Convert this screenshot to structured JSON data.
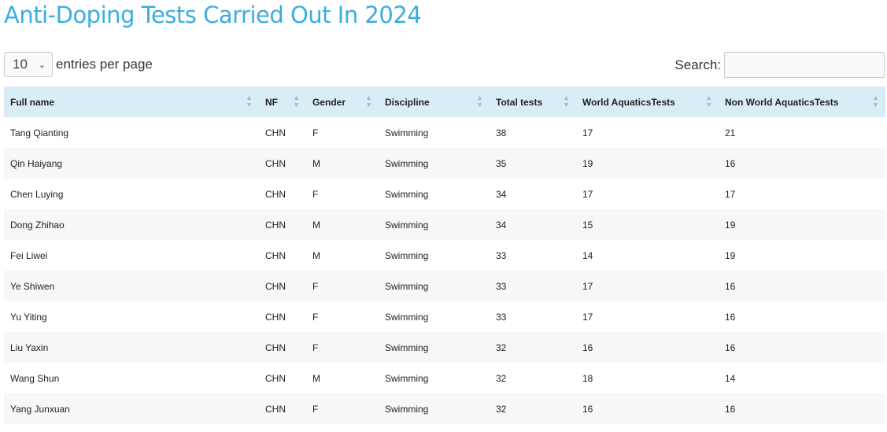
{
  "title": "Anti-Doping Tests Carried Out In 2024",
  "length": {
    "value": "10",
    "label": "entries per page"
  },
  "search": {
    "label": "Search:",
    "value": ""
  },
  "colors": {
    "title": "#3aaee0",
    "header_bg": "#d9edf7"
  },
  "columns": [
    "Full name",
    "NF",
    "Gender",
    "Discipline",
    "Total tests",
    "World AquaticsTests",
    "Non World AquaticsTests"
  ],
  "rows": [
    [
      "Tang Qianting",
      "CHN",
      "F",
      "Swimming",
      "38",
      "17",
      "21"
    ],
    [
      "Qin Haiyang",
      "CHN",
      "M",
      "Swimming",
      "35",
      "19",
      "16"
    ],
    [
      "Chen Luying",
      "CHN",
      "F",
      "Swimming",
      "34",
      "17",
      "17"
    ],
    [
      "Dong Zhihao",
      "CHN",
      "M",
      "Swimming",
      "34",
      "15",
      "19"
    ],
    [
      "Fei Liwei",
      "CHN",
      "M",
      "Swimming",
      "33",
      "14",
      "19"
    ],
    [
      "Ye Shiwen",
      "CHN",
      "F",
      "Swimming",
      "33",
      "17",
      "16"
    ],
    [
      "Yu Yiting",
      "CHN",
      "F",
      "Swimming",
      "33",
      "17",
      "16"
    ],
    [
      "Liu Yaxin",
      "CHN",
      "F",
      "Swimming",
      "32",
      "16",
      "16"
    ],
    [
      "Wang Shun",
      "CHN",
      "M",
      "Swimming",
      "32",
      "18",
      "14"
    ],
    [
      "Yang Junxuan",
      "CHN",
      "F",
      "Swimming",
      "32",
      "16",
      "16"
    ]
  ]
}
